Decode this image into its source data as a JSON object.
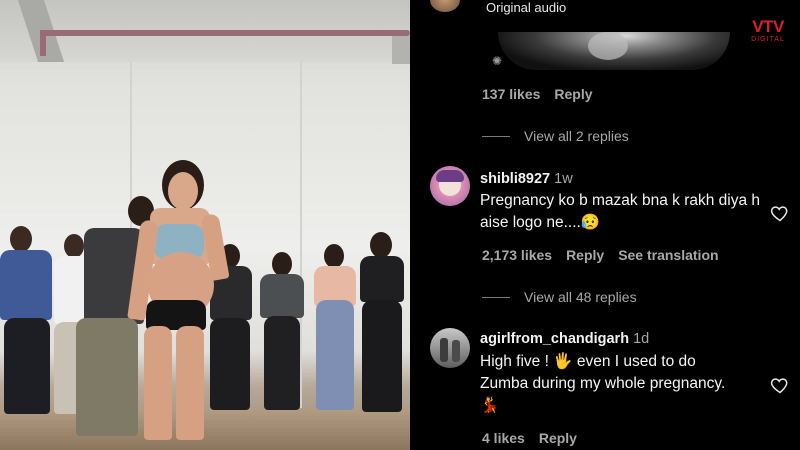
{
  "header": {
    "audio_label": "Original audio"
  },
  "watermark": {
    "brand": "VTV",
    "sub": "DIGITAL",
    "color": "#d6202f"
  },
  "first_comment": {
    "likes": "137 likes",
    "reply": "Reply",
    "view_replies": "View all 2 replies"
  },
  "comments": [
    {
      "username": "shibli8927",
      "time": "1w",
      "text": "Pregnancy ko b mazak bna k rakh diya h aise logo ne....😥",
      "likes": "2,173 likes",
      "reply": "Reply",
      "translate": "See translation",
      "view_replies": "View all 48 replies"
    },
    {
      "username": "agirlfrom_chandigarh",
      "time": "1d",
      "text_line1": "High five ! 🖐️ even I used to do",
      "text_line2": "Zumba during my whole pregnancy.",
      "text_line3": "💃",
      "likes": "4 likes",
      "reply": "Reply"
    }
  ],
  "icons": {
    "heart": "heart-outline-icon",
    "thread": "thread-icon"
  }
}
